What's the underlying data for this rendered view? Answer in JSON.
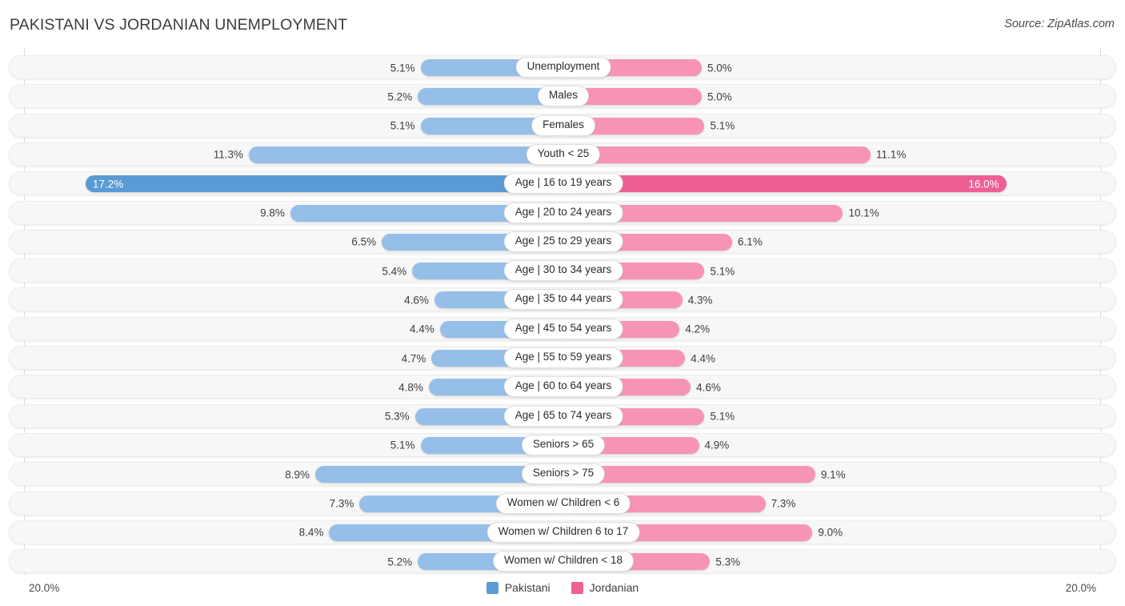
{
  "header": {
    "title": "PAKISTANI VS JORDANIAN UNEMPLOYMENT",
    "source": "Source: ZipAtlas.com"
  },
  "axis": {
    "left_label": "20.0%",
    "right_label": "20.0%"
  },
  "legend": {
    "items": [
      {
        "label": "Pakistani",
        "color": "#5b9bd5"
      },
      {
        "label": "Jordanian",
        "color": "#ef5f93"
      }
    ]
  },
  "colors": {
    "left_bar": "#95bfe8",
    "right_bar": "#f794b5",
    "left_bar_highlight": "#5b9bd5",
    "right_bar_highlight": "#ef5f93",
    "track": "#f7f7f7"
  },
  "chart_data": {
    "type": "bar",
    "title": "PAKISTANI VS JORDANIAN UNEMPLOYMENT",
    "orientation": "horizontal-diverging",
    "xlabel": "",
    "ylabel": "",
    "xlim": [
      20.0,
      20.0
    ],
    "axis_max_percent": 20.0,
    "grid": true,
    "legend_position": "bottom-center",
    "categories": [
      "Unemployment",
      "Males",
      "Females",
      "Youth < 25",
      "Age | 16 to 19 years",
      "Age | 20 to 24 years",
      "Age | 25 to 29 years",
      "Age | 30 to 34 years",
      "Age | 35 to 44 years",
      "Age | 45 to 54 years",
      "Age | 55 to 59 years",
      "Age | 60 to 64 years",
      "Age | 65 to 74 years",
      "Seniors > 65",
      "Seniors > 75",
      "Women w/ Children < 6",
      "Women w/ Children 6 to 17",
      "Women w/ Children < 18"
    ],
    "series": [
      {
        "name": "Pakistani",
        "color": "#5b9bd5",
        "values": [
          5.1,
          5.2,
          5.1,
          11.3,
          17.2,
          9.8,
          6.5,
          5.4,
          4.6,
          4.4,
          4.7,
          4.8,
          5.3,
          5.1,
          8.9,
          7.3,
          8.4,
          5.2
        ]
      },
      {
        "name": "Jordanian",
        "color": "#ef5f93",
        "values": [
          5.0,
          5.0,
          5.1,
          11.1,
          16.0,
          10.1,
          6.1,
          5.1,
          4.3,
          4.2,
          4.4,
          4.6,
          5.1,
          4.9,
          9.1,
          7.3,
          9.0,
          5.3
        ]
      }
    ],
    "highlighted_category": "Age | 16 to 19 years"
  },
  "rows": [
    {
      "label": "Unemployment",
      "left_value": "5.1%",
      "right_value": "5.0%",
      "left_num": 5.1,
      "right_num": 5.0,
      "highlight": false
    },
    {
      "label": "Males",
      "left_value": "5.2%",
      "right_value": "5.0%",
      "left_num": 5.2,
      "right_num": 5.0,
      "highlight": false
    },
    {
      "label": "Females",
      "left_value": "5.1%",
      "right_value": "5.1%",
      "left_num": 5.1,
      "right_num": 5.1,
      "highlight": false
    },
    {
      "label": "Youth < 25",
      "left_value": "11.3%",
      "right_value": "11.1%",
      "left_num": 11.3,
      "right_num": 11.1,
      "highlight": false
    },
    {
      "label": "Age | 16 to 19 years",
      "left_value": "17.2%",
      "right_value": "16.0%",
      "left_num": 17.2,
      "right_num": 16.0,
      "highlight": true
    },
    {
      "label": "Age | 20 to 24 years",
      "left_value": "9.8%",
      "right_value": "10.1%",
      "left_num": 9.8,
      "right_num": 10.1,
      "highlight": false
    },
    {
      "label": "Age | 25 to 29 years",
      "left_value": "6.5%",
      "right_value": "6.1%",
      "left_num": 6.5,
      "right_num": 6.1,
      "highlight": false
    },
    {
      "label": "Age | 30 to 34 years",
      "left_value": "5.4%",
      "right_value": "5.1%",
      "left_num": 5.4,
      "right_num": 5.1,
      "highlight": false
    },
    {
      "label": "Age | 35 to 44 years",
      "left_value": "4.6%",
      "right_value": "4.3%",
      "left_num": 4.6,
      "right_num": 4.3,
      "highlight": false
    },
    {
      "label": "Age | 45 to 54 years",
      "left_value": "4.4%",
      "right_value": "4.2%",
      "left_num": 4.4,
      "right_num": 4.2,
      "highlight": false
    },
    {
      "label": "Age | 55 to 59 years",
      "left_value": "4.7%",
      "right_value": "4.4%",
      "left_num": 4.7,
      "right_num": 4.4,
      "highlight": false
    },
    {
      "label": "Age | 60 to 64 years",
      "left_value": "4.8%",
      "right_value": "4.6%",
      "left_num": 4.8,
      "right_num": 4.6,
      "highlight": false
    },
    {
      "label": "Age | 65 to 74 years",
      "left_value": "5.3%",
      "right_value": "5.1%",
      "left_num": 5.3,
      "right_num": 5.1,
      "highlight": false
    },
    {
      "label": "Seniors > 65",
      "left_value": "5.1%",
      "right_value": "4.9%",
      "left_num": 5.1,
      "right_num": 4.9,
      "highlight": false
    },
    {
      "label": "Seniors > 75",
      "left_value": "8.9%",
      "right_value": "9.1%",
      "left_num": 8.9,
      "right_num": 9.1,
      "highlight": false
    },
    {
      "label": "Women w/ Children < 6",
      "left_value": "7.3%",
      "right_value": "7.3%",
      "left_num": 7.3,
      "right_num": 7.3,
      "highlight": false
    },
    {
      "label": "Women w/ Children 6 to 17",
      "left_value": "8.4%",
      "right_value": "9.0%",
      "left_num": 8.4,
      "right_num": 9.0,
      "highlight": false
    },
    {
      "label": "Women w/ Children < 18",
      "left_value": "5.2%",
      "right_value": "5.3%",
      "left_num": 5.2,
      "right_num": 5.3,
      "highlight": false
    }
  ]
}
